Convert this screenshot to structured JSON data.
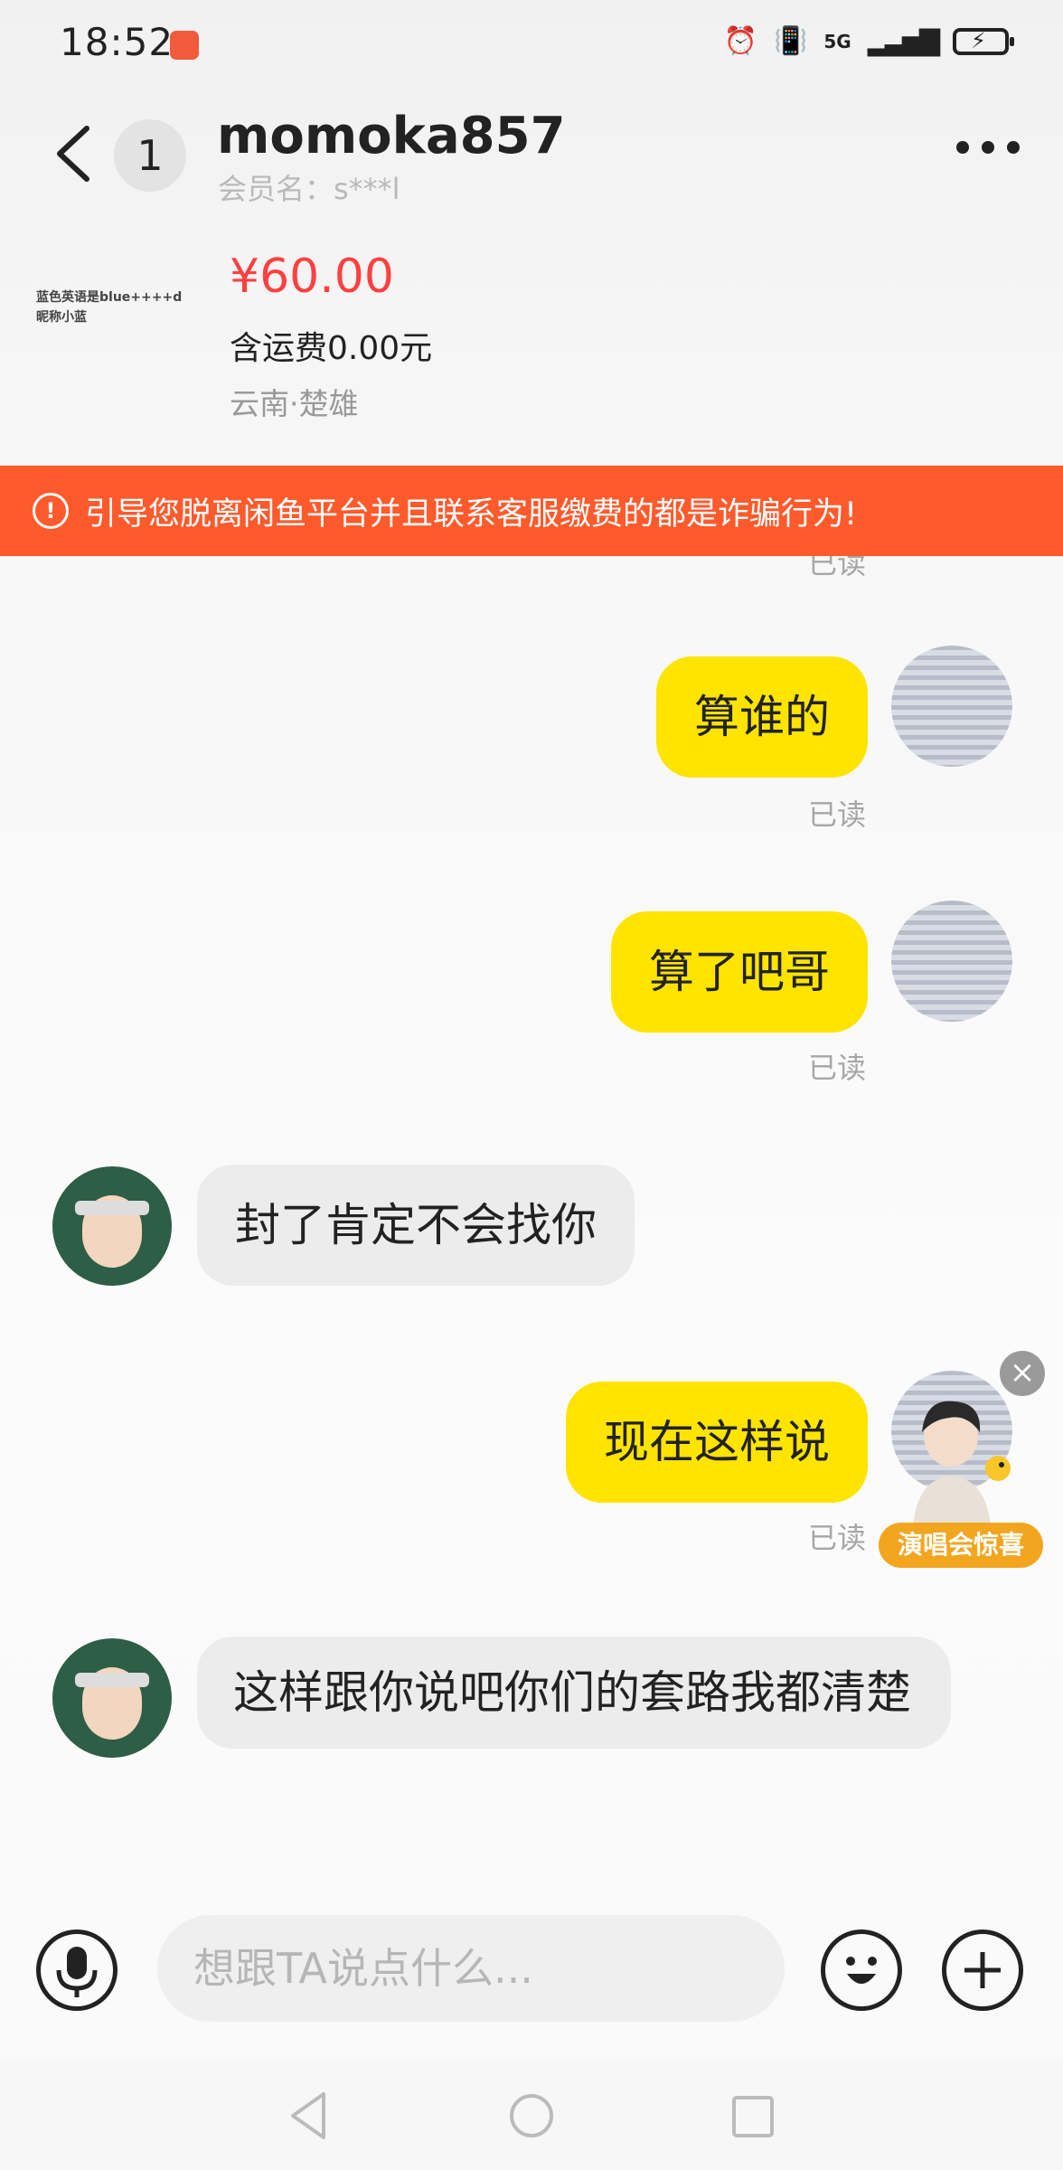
{
  "status_bar": {
    "time": "18:52",
    "network": "5G"
  },
  "header": {
    "unread_count": "1",
    "nickname": "momoka857",
    "member_label": "会员名：s***l",
    "more_icon": "more-dots-icon"
  },
  "product": {
    "thumb_lines": [
      "蓝色英语是blue++++d",
      "昵称小蓝"
    ],
    "price": "¥60.00",
    "shipping": "含运费0.00元",
    "location": "云南·楚雄"
  },
  "warning": {
    "text": "引导您脱离闲鱼平台并且联系客服缴费的都是诈骗行为!",
    "icon": "warning-circle-icon"
  },
  "messages": [
    {
      "from": "me",
      "text": "算谁的",
      "status": "已读"
    },
    {
      "from": "me",
      "text": "算了吧哥",
      "status": "已读"
    },
    {
      "from": "them",
      "text": "封了肯定不会找你"
    },
    {
      "from": "me",
      "text": "现在这样说",
      "status": "已读"
    },
    {
      "from": "them",
      "text": "这样跟你说吧你们的套路我都清楚"
    }
  ],
  "top_partial_status": "已读",
  "popup": {
    "badge": "演唱会惊喜"
  },
  "input": {
    "placeholder": "想跟TA说点什么..."
  },
  "colors": {
    "accent_yellow": "#ffe400",
    "warning_orange": "#ff5a2c",
    "price_red": "#ff4040"
  }
}
